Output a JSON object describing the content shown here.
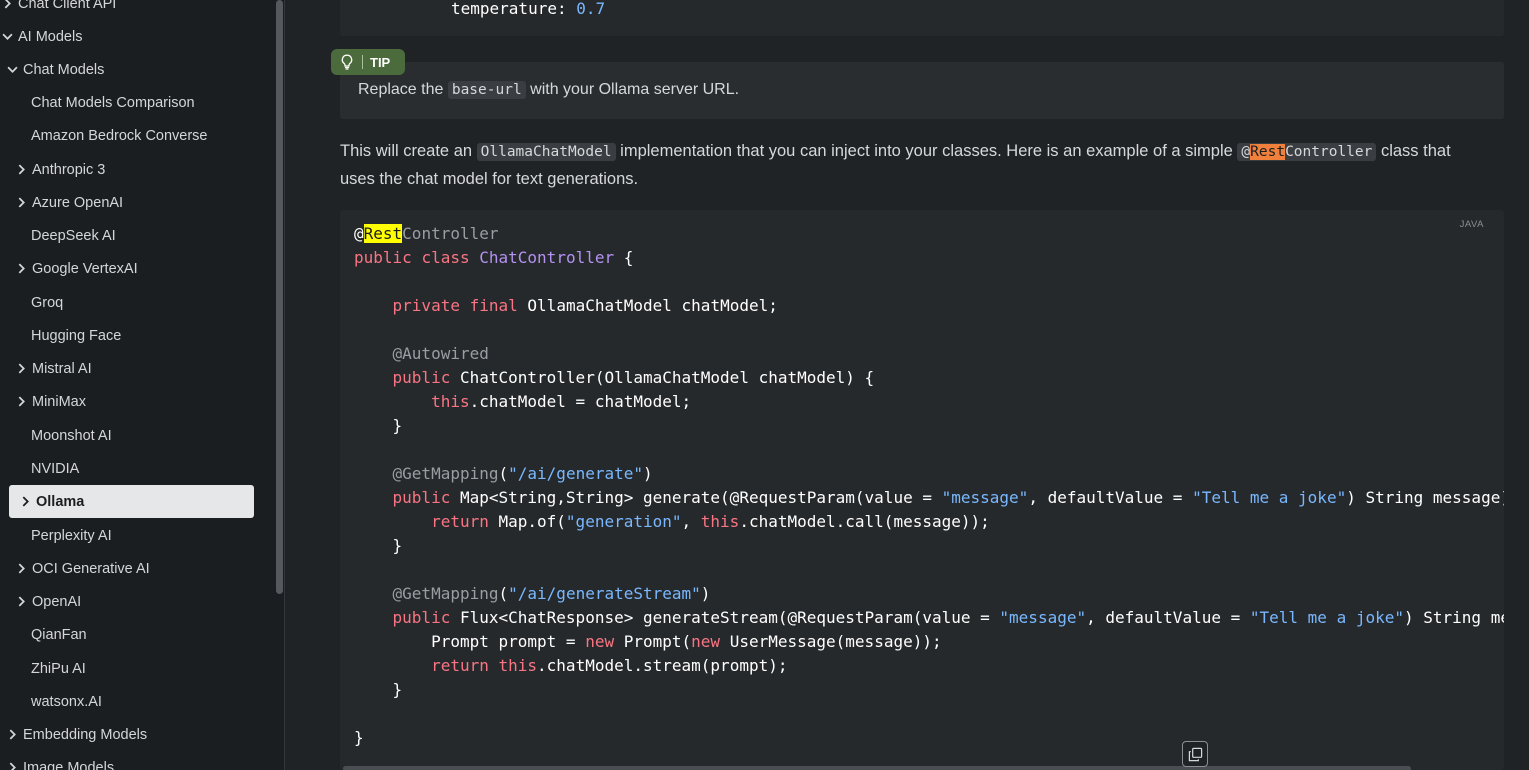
{
  "sidebar": {
    "items": [
      {
        "label": "Chat Client API",
        "chevron": "right"
      },
      {
        "label": "AI Models",
        "chevron": "down"
      },
      {
        "label": "Chat Models",
        "chevron": "down"
      },
      {
        "label": "Chat Models Comparison",
        "chevron": ""
      },
      {
        "label": "Amazon Bedrock Converse",
        "chevron": ""
      },
      {
        "label": "Anthropic 3",
        "chevron": "right"
      },
      {
        "label": "Azure OpenAI",
        "chevron": "right"
      },
      {
        "label": "DeepSeek AI",
        "chevron": ""
      },
      {
        "label": "Google VertexAI",
        "chevron": "right"
      },
      {
        "label": "Groq",
        "chevron": ""
      },
      {
        "label": "Hugging Face",
        "chevron": ""
      },
      {
        "label": "Mistral AI",
        "chevron": "right"
      },
      {
        "label": "MiniMax",
        "chevron": "right"
      },
      {
        "label": "Moonshot AI",
        "chevron": ""
      },
      {
        "label": "NVIDIA",
        "chevron": ""
      },
      {
        "label": "Ollama",
        "chevron": "right",
        "active": true
      },
      {
        "label": "Perplexity AI",
        "chevron": ""
      },
      {
        "label": "OCI Generative AI",
        "chevron": "right"
      },
      {
        "label": "OpenAI",
        "chevron": "right"
      },
      {
        "label": "QianFan",
        "chevron": ""
      },
      {
        "label": "ZhiPu AI",
        "chevron": ""
      },
      {
        "label": "watsonx.AI",
        "chevron": ""
      },
      {
        "label": "Embedding Models",
        "chevron": "right"
      },
      {
        "label": "Image Models",
        "chevron": "right"
      }
    ]
  },
  "top_code": {
    "key": "temperature: ",
    "value": "0.7"
  },
  "tip": {
    "badge": "TIP",
    "text_before": "Replace the ",
    "code": "base-url",
    "text_after": " with your Ollama server URL."
  },
  "paragraph": {
    "part1": "This will create an ",
    "code1": "OllamaChatModel",
    "part2": " implementation that you can inject into your classes. Here is an example of a simple ",
    "code2_at": "@",
    "code2_hl": "Rest",
    "code2_rest": "Controller",
    "part3": " class that uses the chat model for text generations."
  },
  "code_block": {
    "language": "JAVA",
    "copy_icon": "copy-icon"
  },
  "colors": {
    "background": "#202326",
    "sidebar_bg": "#1b1e21",
    "tip_badge": "#4b6b3d",
    "keyword": "#f97583",
    "string": "#79b8ff",
    "class_name": "#b392f0",
    "search_highlight": "#ffff00",
    "inline_highlight": "#f0803c"
  }
}
